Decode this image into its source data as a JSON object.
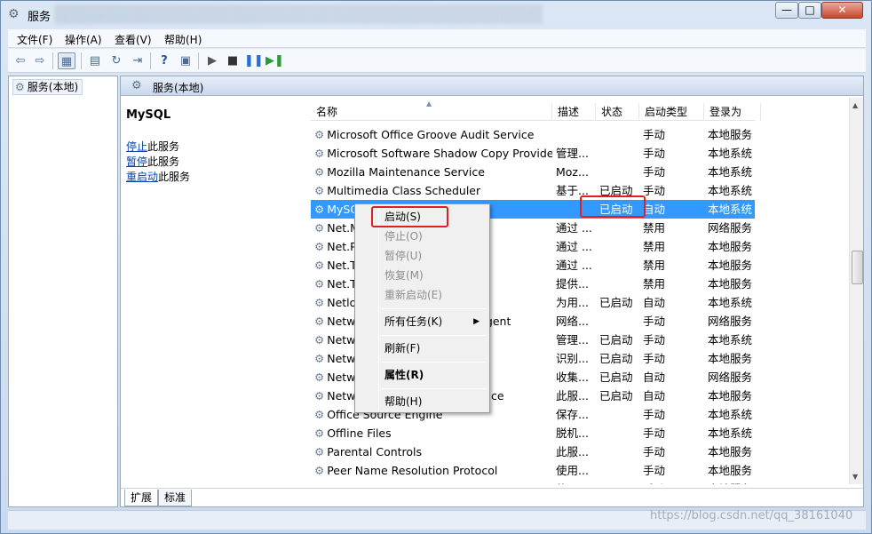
{
  "window": {
    "title": "服务",
    "controls": {
      "minimize": "—",
      "maximize": "□",
      "close": "✕"
    }
  },
  "menubar": [
    "文件(F)",
    "操作(A)",
    "查看(V)",
    "帮助(H)"
  ],
  "tree": {
    "item": "服务(本地)"
  },
  "pane_header": "服务(本地)",
  "detail": {
    "title": "MySQL",
    "actions": [
      {
        "link": "停止",
        "suffix": "此服务"
      },
      {
        "link": "暂停",
        "suffix": "此服务"
      },
      {
        "link": "重启动",
        "suffix": "此服务"
      }
    ]
  },
  "columns": [
    "名称",
    "描述",
    "状态",
    "启动类型",
    "登录为"
  ],
  "rows": [
    {
      "name": "Microsoft Office Groove Audit Service",
      "desc": "",
      "status": "",
      "start": "手动",
      "logon": "本地服务"
    },
    {
      "name": "Microsoft Software Shadow Copy Provider",
      "desc": "管理...",
      "status": "",
      "start": "手动",
      "logon": "本地系统"
    },
    {
      "name": "Mozilla Maintenance Service",
      "desc": "Moz...",
      "status": "",
      "start": "手动",
      "logon": "本地系统"
    },
    {
      "name": "Multimedia Class Scheduler",
      "desc": "基于...",
      "status": "已启动",
      "start": "手动",
      "logon": "本地系统"
    },
    {
      "name": "MySQL",
      "desc": "",
      "status": "已启动",
      "start": "自动",
      "logon": "本地系统"
    },
    {
      "name": "Net.Msmq Listener Adapter",
      "desc": "通过 ...",
      "status": "",
      "start": "禁用",
      "logon": "网络服务"
    },
    {
      "name": "Net.Pipe Listener Adapter",
      "desc": "通过 ...",
      "status": "",
      "start": "禁用",
      "logon": "本地服务"
    },
    {
      "name": "Net.Tcp Listener Adapter",
      "desc": "通过 ...",
      "status": "",
      "start": "禁用",
      "logon": "本地服务"
    },
    {
      "name": "Net.Tcp Port Sharing Service",
      "desc": "提供...",
      "status": "",
      "start": "禁用",
      "logon": "本地服务"
    },
    {
      "name": "Netlogon",
      "desc": "为用...",
      "status": "已启动",
      "start": "自动",
      "logon": "本地系统"
    },
    {
      "name": "Network Access Protection Agent",
      "desc": "网络...",
      "status": "",
      "start": "手动",
      "logon": "网络服务"
    },
    {
      "name": "Network Connections",
      "desc": "管理...",
      "status": "已启动",
      "start": "手动",
      "logon": "本地系统"
    },
    {
      "name": "Network List Service",
      "desc": "识别...",
      "status": "已启动",
      "start": "手动",
      "logon": "本地服务"
    },
    {
      "name": "Network Location Awareness",
      "desc": "收集...",
      "status": "已启动",
      "start": "自动",
      "logon": "网络服务"
    },
    {
      "name": "Network Store Interface Service",
      "desc": "此服...",
      "status": "已启动",
      "start": "自动",
      "logon": "本地服务"
    },
    {
      "name": "Office Source Engine",
      "desc": "保存...",
      "status": "",
      "start": "手动",
      "logon": "本地系统"
    },
    {
      "name": "Offline Files",
      "desc": "脱机...",
      "status": "",
      "start": "手动",
      "logon": "本地系统"
    },
    {
      "name": "Parental Controls",
      "desc": "此服...",
      "status": "",
      "start": "手动",
      "logon": "本地服务"
    },
    {
      "name": "Peer Name Resolution Protocol",
      "desc": "使用...",
      "status": "",
      "start": "手动",
      "logon": "本地服务"
    },
    {
      "name": "Peer Networking Grouping",
      "desc": "使用...",
      "status": "",
      "start": "手动",
      "logon": "本地服务"
    }
  ],
  "selected_row_index": 4,
  "context_menu": {
    "start": "启动(S)",
    "stop": "停止(O)",
    "pause": "暂停(U)",
    "resume": "恢复(M)",
    "restart": "重新启动(E)",
    "all_tasks": "所有任务(K)",
    "refresh": "刷新(F)",
    "properties": "属性(R)",
    "help": "帮助(H)"
  },
  "tabs": [
    "扩展",
    "标准"
  ],
  "watermark": "https://blog.csdn.net/qq_38161040",
  "colors": {
    "selection": "#3399ff",
    "highlight": "#e02020",
    "link": "#0645ad"
  }
}
